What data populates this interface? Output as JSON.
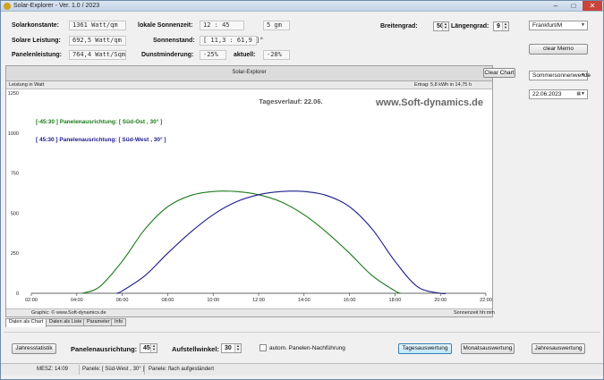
{
  "window": {
    "title": "Solar-Explorer  -  Ver. 1.0 / 2023",
    "min": "–",
    "max": "□",
    "close": "✕"
  },
  "info": {
    "solarkonstante": {
      "label": "Solarkonstante:",
      "value": "1361 Watt/qm"
    },
    "solare_leistung": {
      "label": "Solare Leistung:",
      "value": "692,5 Watt/qm"
    },
    "panelenleistung": {
      "label": "Panelenleistung:",
      "value": "764,4 Watt/Sqm"
    },
    "sonnenzeit": {
      "label": "lokale Sonnenzeit:",
      "value": "12 : 45"
    },
    "sonnenzeit_extra": "5 gm",
    "sonnenstand": {
      "label": "Sonnenstand:",
      "value": "[ 11,3 : 61,9 ]°"
    },
    "dunstminderung": {
      "label": "Dunstminderung:",
      "value": "-25%"
    },
    "aktuell": {
      "label": "aktuell:",
      "value": "-28%"
    }
  },
  "geo": {
    "breitengrad": {
      "label": "Breitengrad:",
      "value": "50"
    },
    "laengengrad": {
      "label": "Längengrad:",
      "value": "9"
    }
  },
  "right_panel": {
    "city": "Frankfurt/M",
    "clear_memo": "clear Memo",
    "preset": "Sommersonnenwende",
    "date": "22.06.2023"
  },
  "chart_header": {
    "title": "Solar-Explorer",
    "clear_chart": "Clear Chart",
    "left_label": "Leistung in Watt",
    "ertrag": "Ertrag:   5,8 kWh in 14,75 h",
    "footer_left": "Graphic: © www.Soft-dynamics.de",
    "footer_right": "Sonnenzeit hh:mm"
  },
  "chart_data": {
    "type": "line",
    "title": "Tagesverlauf: 22.06.",
    "watermark": "www.Soft-dynamics.de",
    "ylabel": "Leistung in Watt",
    "xlabel": "Sonnenzeit hh:mm",
    "xlim": [
      2,
      22
    ],
    "ylim": [
      0,
      1250
    ],
    "x_ticks": [
      "02:00",
      "04:00",
      "06:00",
      "08:00",
      "10:00",
      "12:00",
      "14:00",
      "16:00",
      "18:00",
      "20:00",
      "22:00"
    ],
    "y_ticks": [
      "0",
      "250",
      "500",
      "750",
      "1000",
      "1250"
    ],
    "series": [
      {
        "name": "[-45:30 ] Panelenausrichtung: [ Süd-Ost , 30° ]",
        "color": "#1a7a1a",
        "x": [
          4.25,
          5,
          6,
          7,
          8,
          9,
          10,
          11,
          12,
          13,
          14,
          15,
          16,
          17,
          18,
          18.25
        ],
        "y": [
          0,
          40,
          200,
          400,
          540,
          610,
          635,
          635,
          615,
          570,
          490,
          380,
          250,
          110,
          15,
          0
        ]
      },
      {
        "name": "[ 45:30 ] Panelenausrichtung: [ Süd-West , 30° ]",
        "color": "#1c1c8c",
        "x": [
          5.75,
          6,
          7,
          8,
          9,
          10,
          11,
          12,
          13,
          14,
          15,
          16,
          17,
          18,
          19,
          20,
          20.25
        ],
        "y": [
          0,
          15,
          110,
          250,
          380,
          490,
          570,
          615,
          635,
          635,
          610,
          540,
          400,
          200,
          40,
          0,
          0
        ]
      }
    ]
  },
  "tabs": [
    "Daten als Chart",
    "Daten als Liste",
    "Parameter",
    "Info"
  ],
  "bottom": {
    "jahresstatistik": "Jahresstatistik",
    "panelenausrichtung": {
      "label": "Panelenausrichtung:",
      "value": "45"
    },
    "aufstellwinkel": {
      "label": "Aufstellwinkel:",
      "value": "30"
    },
    "nachfuehrung": "autom. Panelen-Nachführung",
    "tagesauswertung": "Tagesauswertung",
    "monatsauswertung": "Monatsauswertung",
    "jahresauswertung": "Jahresauswertung"
  },
  "status": {
    "time": "MESZ:  14:09",
    "panele": "Panele:  [ Süd-West , 30° ]",
    "aufstellung": "Panele:  flach aufgeständert"
  }
}
